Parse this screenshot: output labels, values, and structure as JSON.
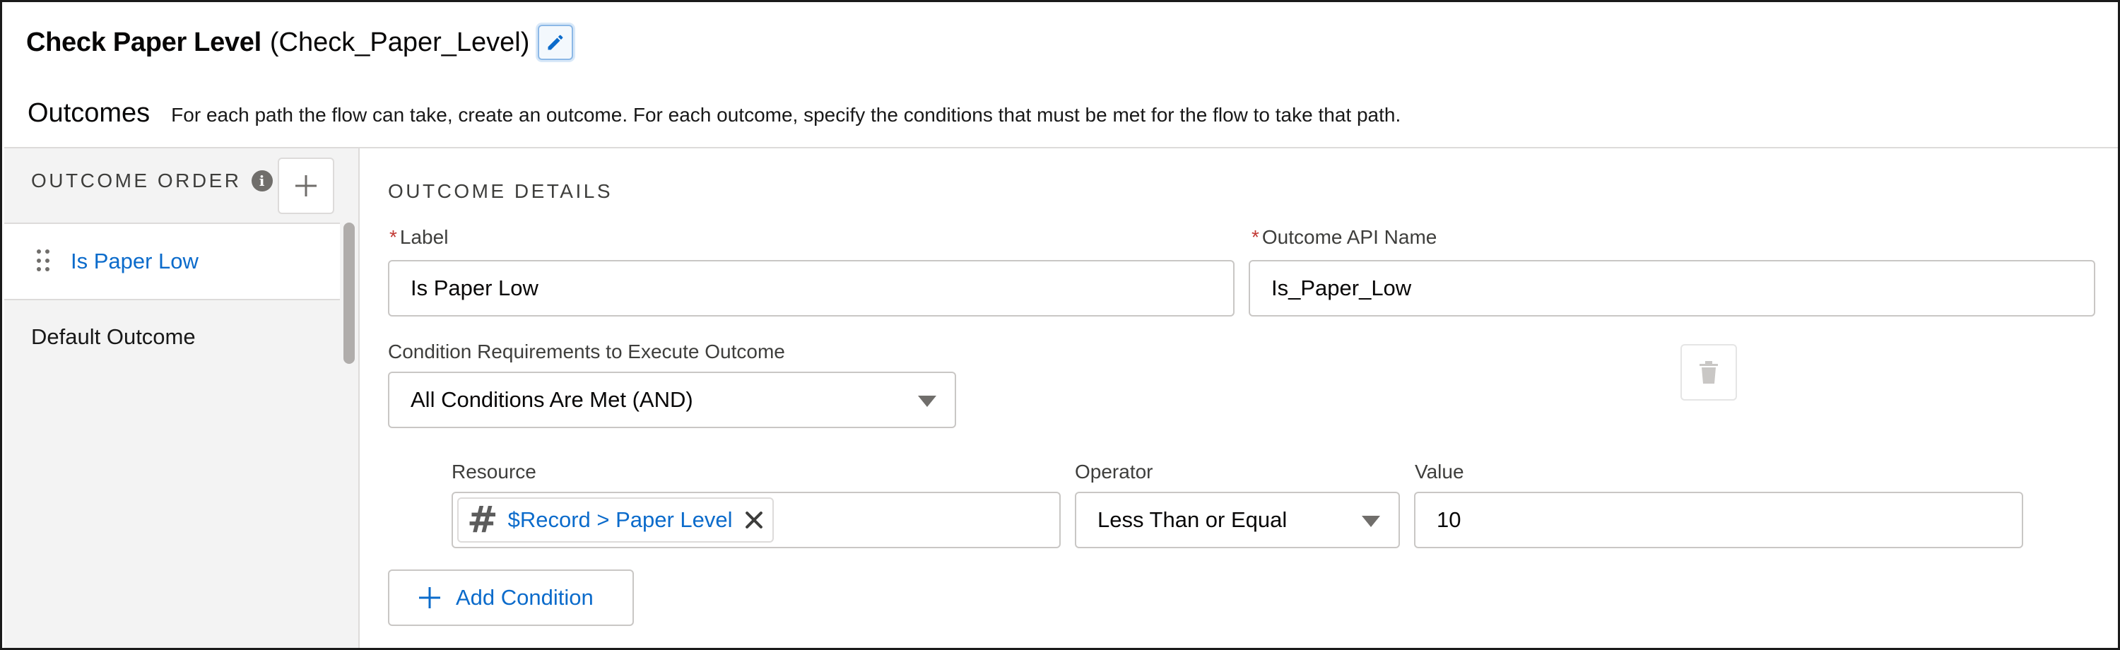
{
  "header": {
    "element_label": "Check Paper Level",
    "element_api": "(Check_Paper_Level)",
    "edit_icon": "pencil-icon"
  },
  "outcomes": {
    "title": "Outcomes",
    "description": "For each path the flow can take, create an outcome. For each outcome, specify the conditions that must be met for the flow to take that path."
  },
  "sidebar": {
    "heading": "OUTCOME ORDER",
    "info_icon": "info-icon",
    "add_icon": "plus-icon",
    "items": [
      {
        "label": "Is Paper Low",
        "active": true
      },
      {
        "label": "Default Outcome",
        "active": false
      }
    ]
  },
  "details": {
    "heading": "OUTCOME DETAILS",
    "label_field": {
      "label": "Label",
      "value": "Is Paper Low"
    },
    "api_field": {
      "label": "Outcome API Name",
      "value": "Is_Paper_Low"
    },
    "condition_req": {
      "label": "Condition Requirements to Execute Outcome",
      "value": "All Conditions Are Met (AND)"
    },
    "condition": {
      "resource_label": "Resource",
      "resource_value": "$Record > Paper Level",
      "resource_icon": "number-hash-icon",
      "operator_label": "Operator",
      "operator_value": "Less Than or Equal",
      "value_label": "Value",
      "value_value": "10"
    },
    "add_condition": "Add Condition"
  },
  "colors": {
    "link": "#0b6bcb",
    "required": "#c23934",
    "sidebar_bg": "#f3f3f3",
    "border": "#c9c7c5"
  }
}
